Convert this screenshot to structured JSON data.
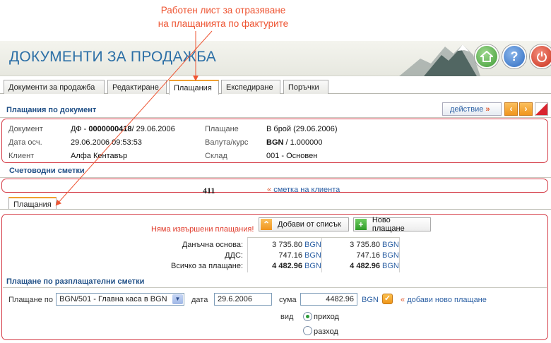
{
  "annotation": {
    "line1": "Работен лист  за отразяване",
    "line2": "на плащанията по фактурите"
  },
  "header": {
    "title": "ДОКУМЕНТИ ЗА ПРОДАЖБА",
    "icons": [
      "home-icon",
      "help-icon",
      "power-icon"
    ]
  },
  "tabs": [
    {
      "label": "Документи за продажба"
    },
    {
      "label": "Редактиране"
    },
    {
      "label": "Плащания",
      "active": true
    },
    {
      "label": "Експедиране"
    },
    {
      "label": "Поръчки"
    }
  ],
  "payments_by_doc": {
    "title": "Плащания по документ",
    "action_label": "действие",
    "action_arrow": "»",
    "prev": "‹",
    "next": "›"
  },
  "doc": {
    "document_label": "Документ",
    "document_prefix": "ДФ - ",
    "document_number": "0000000418",
    "document_date": "/ 29.06.2006",
    "tax_date_label": "Дата осч.",
    "tax_date_value": "29.06.2006 09:53:53",
    "client_label": "Клиент",
    "client_value": "Алфа Кентавър",
    "payment_label": "Плащане",
    "payment_value": "В брой (29.06.2006)",
    "currency_label": "Валута/курс",
    "currency_code": "BGN",
    "currency_rate": " / 1.000000",
    "warehouse_label": "Склад",
    "warehouse_value": "001 - Основен"
  },
  "accounts": {
    "title": "Счетоводни сметки",
    "number": "411",
    "link_prefix": "«",
    "link_label": "сметка на клиента"
  },
  "sub_tab": {
    "label": "Плащания"
  },
  "payments": {
    "no_payments": "Няма извършени плащания!",
    "add_from_list": "Добави от списък",
    "new_payment": "Ново плащане",
    "rows": [
      {
        "label": "Данъчна основа:",
        "v1": "3 735.80",
        "c1": "BGN",
        "v2": "3 735.80",
        "c2": "BGN"
      },
      {
        "label": "ДДС:",
        "v1": "747.16",
        "c1": "BGN",
        "v2": "747.16",
        "c2": "BGN"
      },
      {
        "label": "Всичко за плащане:",
        "v1": "4 482.96",
        "c1": "BGN",
        "v2": "4 482.96",
        "c2": "BGN"
      }
    ]
  },
  "settlement": {
    "title": "Плащане по разплащателни сметки",
    "pay_by_label": "Плащане по",
    "pay_by_value": "BGN/501 - Главна каса в BGN",
    "date_label": "дата",
    "date_value": "29.6.2006",
    "amount_label": "сума",
    "amount_value": "4482.96",
    "amount_currency": "BGN",
    "add_prefix": "«",
    "add_label": "добави ново плащане",
    "kind_label": "вид",
    "kind_options": [
      "приход",
      "разход"
    ],
    "kind_selected": "приход"
  },
  "colors": {
    "accent_blue": "#2c6fa6",
    "section_blue": "#1f4f86",
    "highlight_red": "#d43a45",
    "orange": "#f0951e",
    "callout": "#e53"
  }
}
